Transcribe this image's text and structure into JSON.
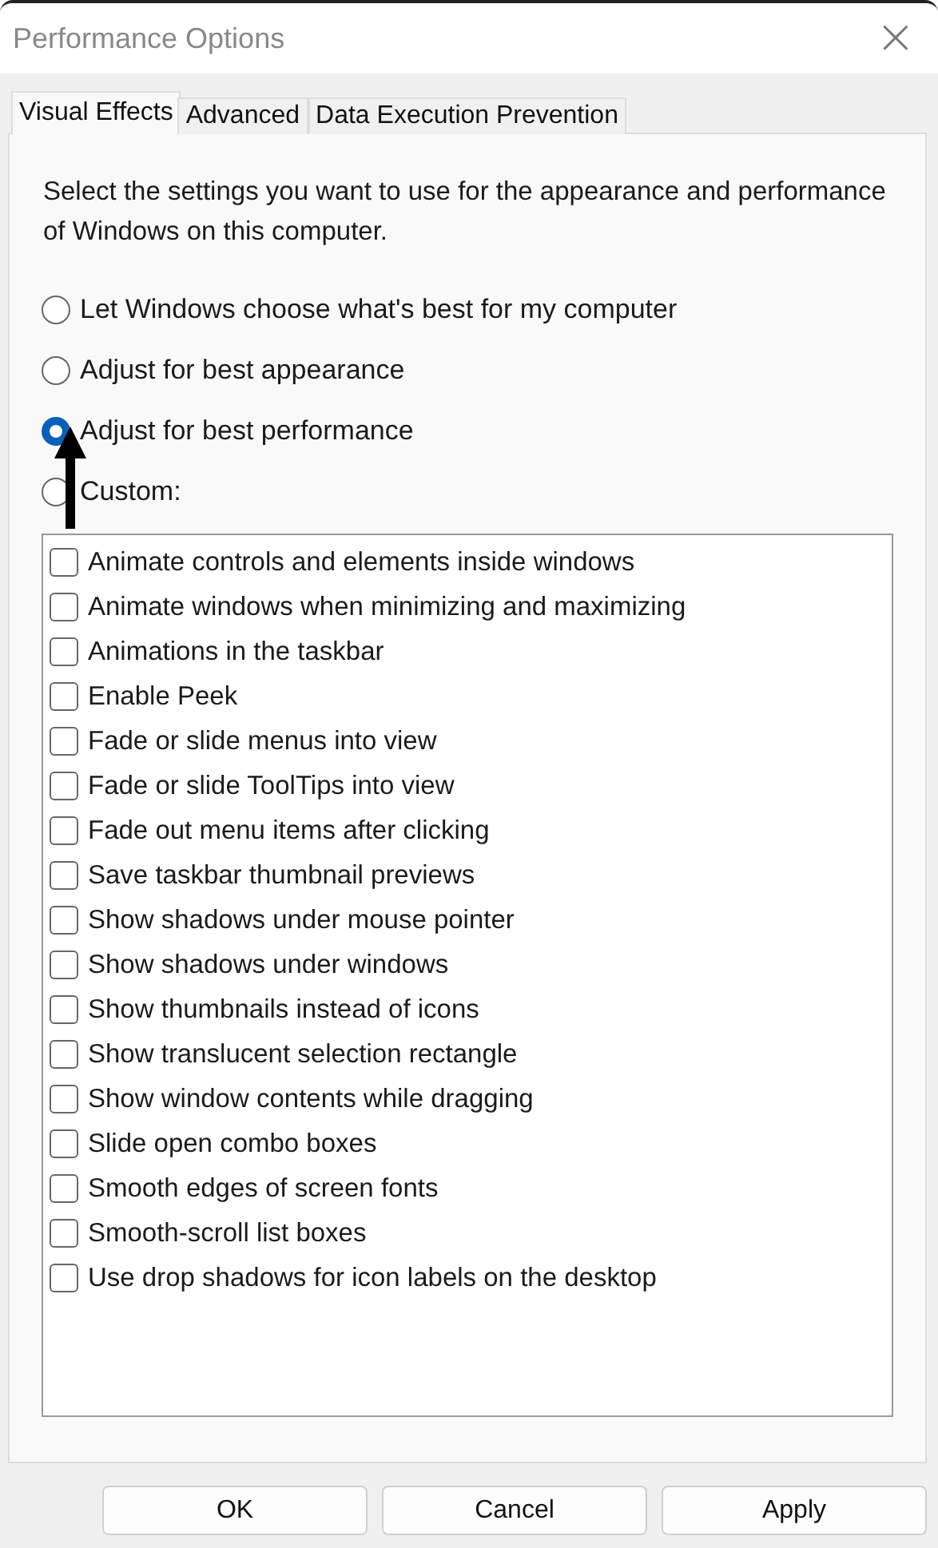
{
  "window": {
    "title": "Performance Options",
    "close": "×"
  },
  "tabs": [
    {
      "label": "Visual Effects",
      "selected": true
    },
    {
      "label": "Advanced",
      "selected": false
    },
    {
      "label": "Data Execution Prevention",
      "selected": false
    }
  ],
  "description": "Select the settings you want to use for the appearance and performance of Windows on this computer.",
  "options": [
    {
      "label": "Let Windows choose what's best for my computer",
      "selected": false
    },
    {
      "label": "Adjust for best appearance",
      "selected": false
    },
    {
      "label": "Adjust for best performance",
      "selected": true
    },
    {
      "label": "Custom:",
      "selected": false
    }
  ],
  "effects": [
    {
      "label": "Animate controls and elements inside windows",
      "checked": false
    },
    {
      "label": "Animate windows when minimizing and maximizing",
      "checked": false
    },
    {
      "label": "Animations in the taskbar",
      "checked": false
    },
    {
      "label": "Enable Peek",
      "checked": false
    },
    {
      "label": "Fade or slide menus into view",
      "checked": false
    },
    {
      "label": "Fade or slide ToolTips into view",
      "checked": false
    },
    {
      "label": "Fade out menu items after clicking",
      "checked": false
    },
    {
      "label": "Save taskbar thumbnail previews",
      "checked": false
    },
    {
      "label": "Show shadows under mouse pointer",
      "checked": false
    },
    {
      "label": "Show shadows under windows",
      "checked": false
    },
    {
      "label": "Show thumbnails instead of icons",
      "checked": false
    },
    {
      "label": "Show translucent selection rectangle",
      "checked": false
    },
    {
      "label": "Show window contents while dragging",
      "checked": false
    },
    {
      "label": "Slide open combo boxes",
      "checked": false
    },
    {
      "label": "Smooth edges of screen fonts",
      "checked": false
    },
    {
      "label": "Smooth-scroll list boxes",
      "checked": false
    },
    {
      "label": "Use drop shadows for icon labels on the desktop",
      "checked": false
    }
  ],
  "buttons": [
    "OK",
    "Cancel",
    "Apply"
  ]
}
